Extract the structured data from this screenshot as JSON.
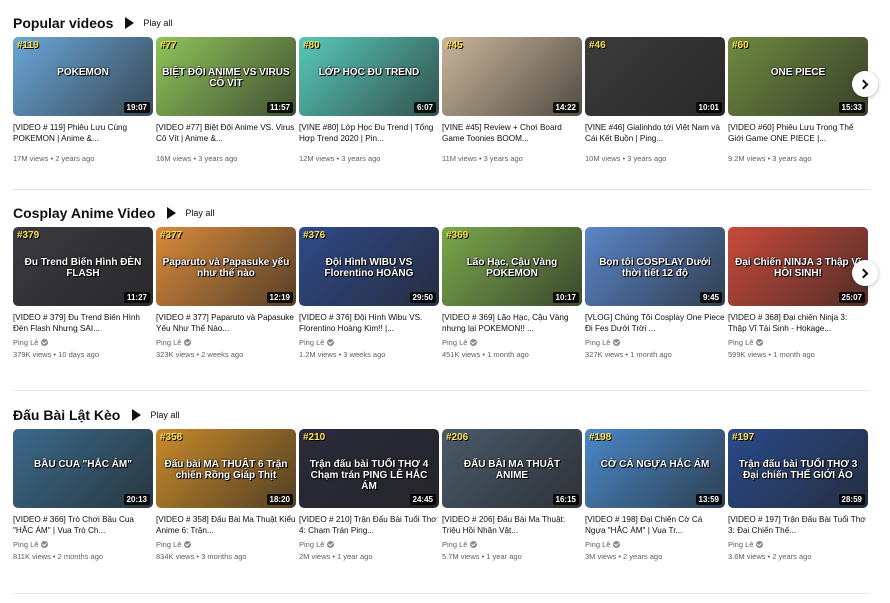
{
  "play_all_label": "Play all",
  "shelves": [
    {
      "title": "Popular videos",
      "videos": [
        {
          "title": "[VIDEO # 119] Phiêu Lưu Cùng POKEMON | Anime &...",
          "channel": "",
          "meta": "17M views • 2 years ago",
          "duration": "19:07",
          "badge": "#119",
          "caption": "POKEMON",
          "bg": "#6aa7d8"
        },
        {
          "title": "[VIDEO #77] Biệt Đội Anime VS. Virus Cô Vít | Anime &...",
          "channel": "",
          "meta": "16M views • 3 years ago",
          "duration": "11:57",
          "badge": "#77",
          "caption": "BIỆT ĐỘI ANIME VS VIRUS CÔ VÍT",
          "bg": "#8fc45a"
        },
        {
          "title": "[VINE #80] Lớp Học Đu Trend | Tổng Hợp Trend 2020 | Pin...",
          "channel": "",
          "meta": "12M views • 3 years ago",
          "duration": "6:07",
          "badge": "#80",
          "caption": "LỚP HỌC ĐU TREND",
          "bg": "#58c8b8"
        },
        {
          "title": "[VINE #45] Review + Chơi Board Game Toonies BOOM...",
          "channel": "",
          "meta": "11M views • 3 years ago",
          "duration": "14:22",
          "badge": "#45",
          "caption": "",
          "bg": "#c9b59a"
        },
        {
          "title": "[VINE #46] Gialinhdo tới Việt Nam và Cái Kết Buồn | Ping...",
          "channel": "",
          "meta": "10M views • 3 years ago",
          "duration": "10:01",
          "badge": "#46",
          "caption": "",
          "bg": "#3b3b3b"
        },
        {
          "title": "[VIDEO #60] Phiêu Lưu Trong Thế Giới Game ONE PIECE |...",
          "channel": "",
          "meta": "9.2M views • 3 years ago",
          "duration": "15:33",
          "badge": "#60",
          "caption": "ONE PIECE",
          "bg": "#6f8a3f"
        }
      ]
    },
    {
      "title": "Cosplay Anime Video",
      "videos": [
        {
          "title": "[VIDEO # 379] Đu Trend Biến Hình Đèn Flash Nhưng SAI...",
          "channel": "Ping Lê",
          "meta": "379K views • 10 days ago",
          "duration": "11:27",
          "badge": "#379",
          "caption": "Đu Trend Biến Hình ĐÈN FLASH",
          "bg": "#3a3a40"
        },
        {
          "title": "[VIDEO # 377] Paparuto và Papasuke Yếu Như Thế Nào...",
          "channel": "Ping Lê",
          "meta": "323K views • 2 weeks ago",
          "duration": "12:19",
          "badge": "#377",
          "caption": "Paparuto và Papasuke yếu như thế nào",
          "bg": "#d98a3a"
        },
        {
          "title": "[VIDEO # 376] Đội Hình Wibu VS. Florentino Hoàng Kim!! |...",
          "channel": "Ping Lê",
          "meta": "1.2M views • 3 weeks ago",
          "duration": "29:50",
          "badge": "#376",
          "caption": "Đội Hình WIBU VS Florentino HOÀNG",
          "bg": "#2f4a8a"
        },
        {
          "title": "[VIDEO # 369] Lão Hạc, Cậu Vàng nhưng lại POKEMON!! ...",
          "channel": "Ping Lê",
          "meta": "451K views • 1 month ago",
          "duration": "10:17",
          "badge": "#369",
          "caption": "Lão Hạc, Cậu Vàng POKEMON",
          "bg": "#7aa84a"
        },
        {
          "title": "[VLOG] Chúng Tôi Cosplay One Piece Đi Fes Dưới Trời ...",
          "channel": "Ping Lê",
          "meta": "327K views • 1 month ago",
          "duration": "9:45",
          "badge": "",
          "caption": "Bọn tôi COSPLAY Dưới thời tiết 12 độ",
          "bg": "#5a86c8"
        },
        {
          "title": "[VIDEO # 368] Đại chiến Ninja 3: Thập Vĩ Tái Sinh - Hokage...",
          "channel": "Ping Lê",
          "meta": "599K views • 1 month ago",
          "duration": "25:07",
          "badge": "",
          "caption": "Đại Chiến NINJA 3 Thập Vĩ HỒI SINH!",
          "bg": "#c84a3a"
        }
      ]
    },
    {
      "title": "Đấu Bài Lật Kèo",
      "videos": [
        {
          "title": "[VIDEO # 366] Trò Chơi Bầu Cua \"HẮC ÁM\" | Vua Trò Ch...",
          "channel": "Ping Lê",
          "meta": "811K views • 2 months ago",
          "duration": "20:13",
          "badge": "",
          "caption": "BẦU CUA \"HẮC ÁM\"",
          "bg": "#3a6a8a"
        },
        {
          "title": "[VIDEO # 358] Đấu Bài Ma Thuật Kiểu Anime 6: Trận...",
          "channel": "Ping Lê",
          "meta": "834K views • 3 months ago",
          "duration": "18:20",
          "badge": "#358",
          "caption": "Đấu bài MA THUẬT 6 Trận chiến Rồng Giáp Thịt",
          "bg": "#c88a2a"
        },
        {
          "title": "[VIDEO # 210] Trận Đấu Bài Tuổi Thơ 4: Chạm Trán Ping...",
          "channel": "Ping Lê",
          "meta": "2M views • 1 year ago",
          "duration": "24:45",
          "badge": "#210",
          "caption": "Trận đấu bài TUỔI THƠ 4 Chạm trán PING LÊ HẮC ÁM",
          "bg": "#2a2a3a"
        },
        {
          "title": "[VIDEO # 206] Đấu Bài Ma Thuật: Triệu Hồi Nhân Vật...",
          "channel": "Ping Lê",
          "meta": "5.7M views • 1 year ago",
          "duration": "16:15",
          "badge": "#206",
          "caption": "ĐẤU BÀI MA THUẬT ANIME",
          "bg": "#4a5a6a"
        },
        {
          "title": "[VIDEO # 198] Đại Chiến Cờ Cá Ngựa \"HẮC ÁM\" | Vua Tr...",
          "channel": "Ping Lê",
          "meta": "3M views • 2 years ago",
          "duration": "13:59",
          "badge": "#198",
          "caption": "CỜ CÁ NGỰA HẮC ÁM",
          "bg": "#4a88c8"
        },
        {
          "title": "[VIDEO # 197] Trận Đấu Bài Tuổi Thơ 3: Đại Chiến Thế...",
          "channel": "Ping Lê",
          "meta": "3.6M views • 2 years ago",
          "duration": "28:59",
          "badge": "#197",
          "caption": "Trận đấu bài TUỔI THƠ 3 Đại chiến THẾ GIỚI ẢO",
          "bg": "#2a4a8a"
        }
      ]
    }
  ]
}
